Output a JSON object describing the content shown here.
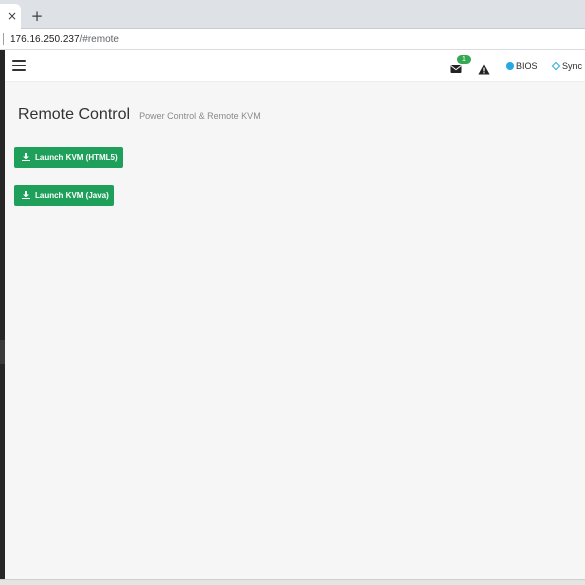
{
  "browser": {
    "tab_close_glyph": "×",
    "new_tab_glyph": "+",
    "url_host": "176.16.250.237",
    "url_path": "/#remote"
  },
  "header": {
    "icons": {
      "menu": "hamburger-icon",
      "messages": "envelope-icon",
      "alert": "warning-icon",
      "bios": "circle-icon",
      "sync": "diamond-icon"
    },
    "message_count": "1",
    "bios_label": "BIOS",
    "sync_label": "Sync",
    "colors": {
      "badge": "#34a853",
      "bios_accent": "#29a8e0"
    }
  },
  "main": {
    "title": "Remote Control",
    "subtitle": "Power Control & Remote KVM",
    "buttons": [
      {
        "label": "Launch KVM (HTML5)",
        "icon": "download-icon"
      },
      {
        "label": "Launch KVM (Java)",
        "icon": "download-icon"
      }
    ],
    "colors": {
      "button_bg": "#1fa05a"
    }
  }
}
